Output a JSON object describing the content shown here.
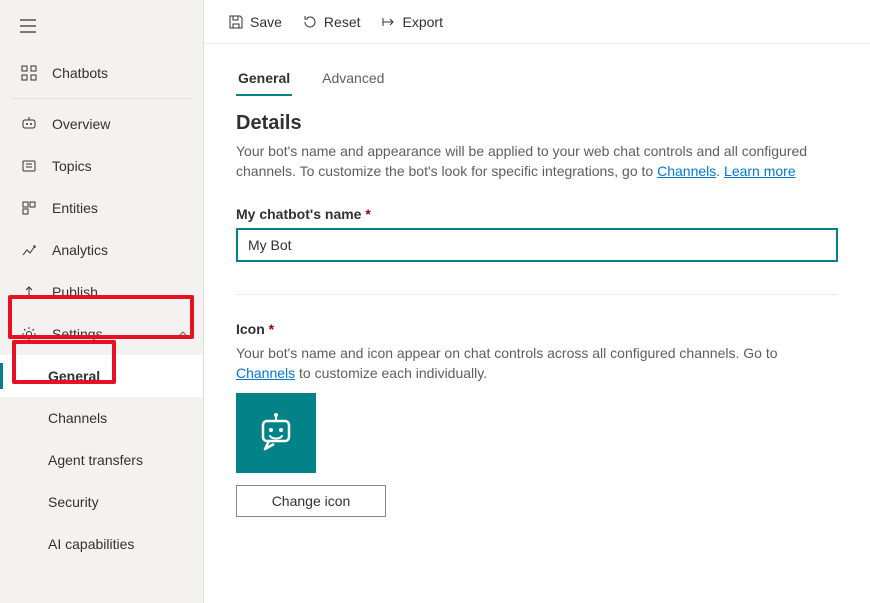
{
  "sidebar": {
    "chatbots": "Chatbots",
    "items": [
      {
        "label": "Overview"
      },
      {
        "label": "Topics"
      },
      {
        "label": "Entities"
      },
      {
        "label": "Analytics"
      },
      {
        "label": "Publish"
      }
    ],
    "settings": {
      "label": "Settings",
      "subs": [
        {
          "label": "General"
        },
        {
          "label": "Channels"
        },
        {
          "label": "Agent transfers"
        },
        {
          "label": "Security"
        },
        {
          "label": "AI capabilities"
        }
      ]
    }
  },
  "toolbar": {
    "save": "Save",
    "reset": "Reset",
    "export": "Export"
  },
  "tabs": {
    "general": "General",
    "advanced": "Advanced"
  },
  "details": {
    "title": "Details",
    "desc_a": "Your bot's name and appearance will be applied to your web chat controls and all configured channels. To customize the bot's look for specific integrations, go to ",
    "channels_link": "Channels",
    "sep": ". ",
    "learn_link": "Learn more",
    "name_label": "My chatbot's name",
    "name_value": "My Bot",
    "icon_label": "Icon",
    "icon_desc_a": "Your bot's name and icon appear on chat controls across all configured channels. Go to ",
    "icon_channels_link": "Channels",
    "icon_desc_b": " to customize each individually.",
    "change_icon": "Change icon"
  }
}
